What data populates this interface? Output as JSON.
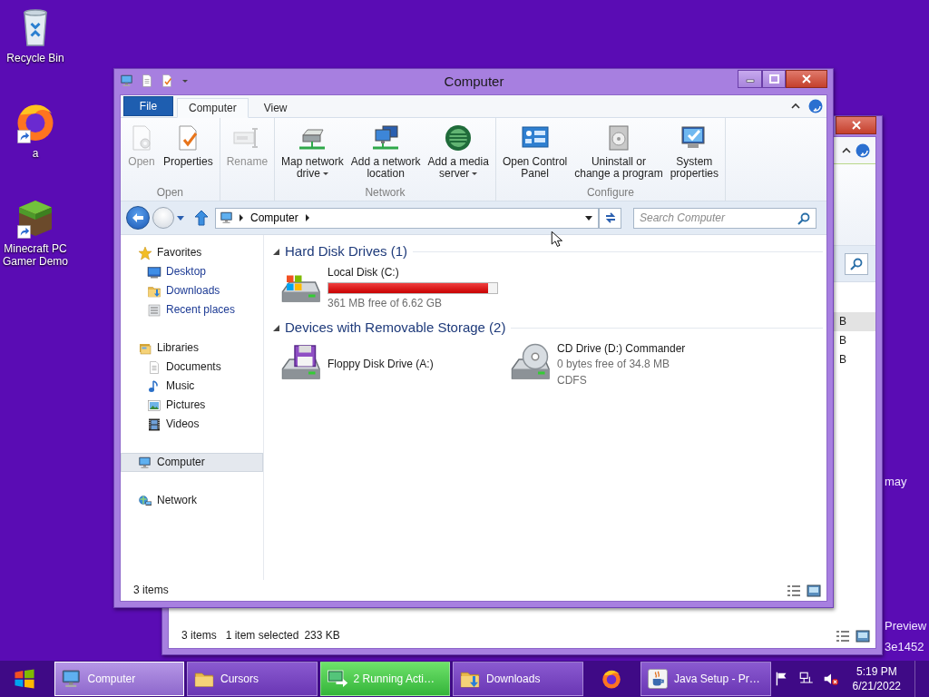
{
  "desktop_icons": [
    {
      "label": "Recycle Bin",
      "kind": "recycle",
      "shortcut": false
    },
    {
      "label": "a",
      "kind": "browser",
      "shortcut": true
    },
    {
      "label": "Minecraft PC Gamer Demo",
      "kind": "grass",
      "shortcut": true
    }
  ],
  "desktop_text": [
    "may",
    "Preview",
    "3e1452"
  ],
  "background_window": {
    "rows": [
      {
        "fragment": "B",
        "selected": true
      },
      {
        "fragment": "B",
        "selected": false
      },
      {
        "fragment": "B",
        "selected": false
      }
    ],
    "status_bar": {
      "items": "3 items",
      "selection": "1 item selected",
      "size": "233 KB"
    }
  },
  "window": {
    "title": "Computer",
    "ribbon_tabs": [
      {
        "label": "File",
        "kind": "file",
        "selected": false
      },
      {
        "label": "Computer",
        "kind": "tab",
        "selected": true
      },
      {
        "label": "View",
        "kind": "tab",
        "selected": false
      }
    ],
    "ribbon_groups": [
      {
        "label": "Open",
        "buttons": [
          {
            "label": "Open",
            "kind": "open",
            "disabled": true,
            "dropdown": false
          },
          {
            "label": "Properties",
            "kind": "properties",
            "disabled": false,
            "dropdown": false
          }
        ]
      },
      {
        "buttons": [
          {
            "label": "Rename",
            "kind": "rename",
            "disabled": true,
            "dropdown": false
          }
        ]
      },
      {
        "label": "Network",
        "buttons": [
          {
            "label": "Map network\ndrive",
            "kind": "mapdrive",
            "disabled": false,
            "dropdown": true
          },
          {
            "label": "Add a network\nlocation",
            "kind": "netloc",
            "disabled": false,
            "dropdown": false
          },
          {
            "label": "Add a media\nserver",
            "kind": "media",
            "disabled": false,
            "dropdown": true
          }
        ]
      },
      {
        "label": "Configure",
        "buttons": [
          {
            "label": "Open Control\nPanel",
            "kind": "control",
            "disabled": false,
            "dropdown": false
          },
          {
            "label": "Uninstall or\nchange a program",
            "kind": "uninstall",
            "disabled": false,
            "dropdown": false
          },
          {
            "label": "System\nproperties",
            "kind": "sysprops",
            "disabled": false,
            "dropdown": false
          }
        ]
      }
    ],
    "address": {
      "path": [
        "Computer"
      ]
    },
    "search": {
      "placeholder": "Search Computer"
    },
    "navigation": [
      {
        "label": "Favorites",
        "kind": "star",
        "selected": false,
        "children": [
          {
            "label": "Desktop",
            "kind": "desktop",
            "link": true,
            "selected": false
          },
          {
            "label": "Downloads",
            "kind": "downloads",
            "link": true,
            "selected": false
          },
          {
            "label": "Recent places",
            "kind": "recent",
            "link": true,
            "selected": false
          }
        ]
      },
      {
        "label": "Libraries",
        "kind": "libraries",
        "selected": false,
        "children": [
          {
            "label": "Documents",
            "kind": "documents",
            "link": false,
            "selected": false
          },
          {
            "label": "Music",
            "kind": "music",
            "link": false,
            "selected": false
          },
          {
            "label": "Pictures",
            "kind": "pictures",
            "link": false,
            "selected": false
          },
          {
            "label": "Videos",
            "kind": "videos",
            "link": false,
            "selected": false
          }
        ]
      },
      {
        "label": "Computer",
        "kind": "computer",
        "selected": true
      },
      {
        "label": "Network",
        "kind": "network",
        "selected": false
      }
    ],
    "groups": [
      {
        "title": "Hard Disk Drives (1)",
        "expanded": true,
        "items": [
          {
            "name": "Local Disk (C:)",
            "kind": "hdd",
            "level": 0.947,
            "details": [
              "361 MB free of 6.62 GB"
            ]
          }
        ]
      },
      {
        "title": "Devices with Removable Storage (2)",
        "expanded": true,
        "items": [
          {
            "name": "Floppy Disk Drive (A:)",
            "kind": "floppy"
          },
          {
            "name": "CD Drive (D:) Commander",
            "kind": "cd",
            "details": [
              "0 bytes free of 34.8 MB",
              "CDFS"
            ]
          }
        ]
      }
    ],
    "status_bar": {
      "items": "3 items"
    }
  },
  "taskbar": {
    "buttons": [
      {
        "label": "Computer",
        "kind": "computer",
        "selected": true,
        "progress": false
      },
      {
        "label": "Cursors",
        "kind": "folder",
        "selected": false,
        "progress": false
      },
      {
        "label": "2 Running Acti…",
        "kind": "copy",
        "selected": false,
        "progress": true
      },
      {
        "label": "Downloads",
        "kind": "downloads",
        "selected": false,
        "progress": false
      },
      {
        "kind": "browser",
        "selected": false,
        "progress": false
      },
      {
        "label": "Java Setup - Pr…",
        "kind": "java",
        "selected": false,
        "progress": false
      }
    ],
    "tray": {
      "volume_muted": true
    },
    "clock": {
      "time": "5:19 PM",
      "date": "6/21/2022"
    }
  }
}
